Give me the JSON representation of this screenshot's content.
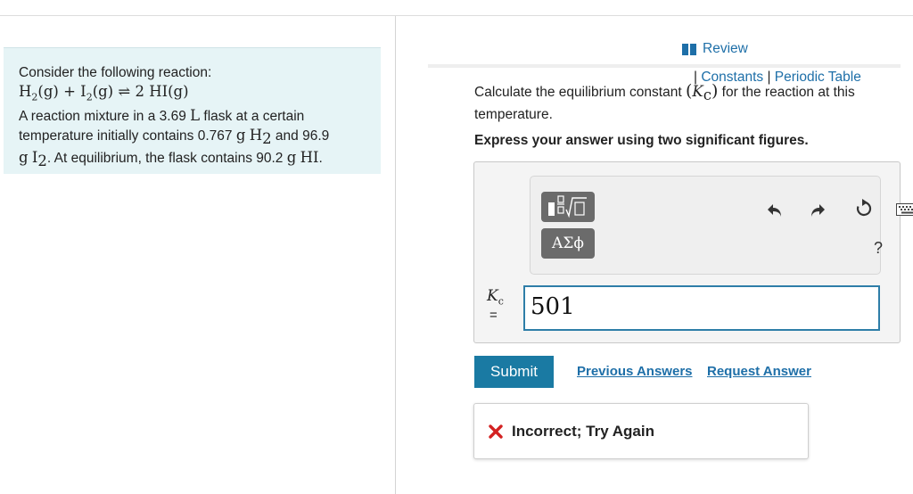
{
  "problem": {
    "intro": "Consider the following reaction:",
    "reaction": {
      "r1_sym": "H",
      "r1_sub": "2",
      "r1_state": "(g)",
      "plus": "+",
      "r2_sym": "I",
      "r2_sub": "2",
      "r2_state": "(g)",
      "arrow": "⇌",
      "product": "2 HI(g)"
    },
    "line1": "A reaction mixture in a 3.69 ",
    "unit_L": "L",
    "line1_end": " flask at a certain",
    "line2_start": "temperature initially contains 0.767 ",
    "g1": "g",
    "h2_sym": "H",
    "h2_sub": "2",
    "line2_end": " and 96.9",
    "g2": "g",
    "i2_sym": "I",
    "i2_sub": "2",
    "line3_mid": ". At equilibrium, the flask contains 90.2 ",
    "g3": "g",
    "hi": "HI",
    "period": "."
  },
  "header": {
    "review": "Review",
    "links_prefix": "| ",
    "constants": "Constants",
    "links_sep": " | ",
    "periodic_table": "Periodic Table"
  },
  "question": {
    "text_before": "Calculate the equilibrium constant ",
    "paren_open": "(",
    "k_symbol": "K",
    "k_sub": "c",
    "paren_close": ")",
    "text_after": " for the reaction at this temperature.",
    "instruction": "Express your answer using two significant figures."
  },
  "toolbar": {
    "greek_label": "ΑΣϕ",
    "help_label": "?",
    "icons": [
      "templates-icon",
      "undo-icon",
      "redo-icon",
      "reset-icon",
      "keyboard-icon"
    ]
  },
  "answer": {
    "label_symbol": "K",
    "label_sub": "c",
    "equals": "=",
    "value": "501"
  },
  "actions": {
    "submit": "Submit",
    "previous_answers": "Previous Answers",
    "request_answer": "Request Answer"
  },
  "feedback": {
    "text": "Incorrect; Try Again"
  },
  "colors": {
    "accent": "#1a7aa3",
    "link": "#1e6fa8",
    "panel_bg": "#e6f4f6",
    "error": "#d32222"
  }
}
